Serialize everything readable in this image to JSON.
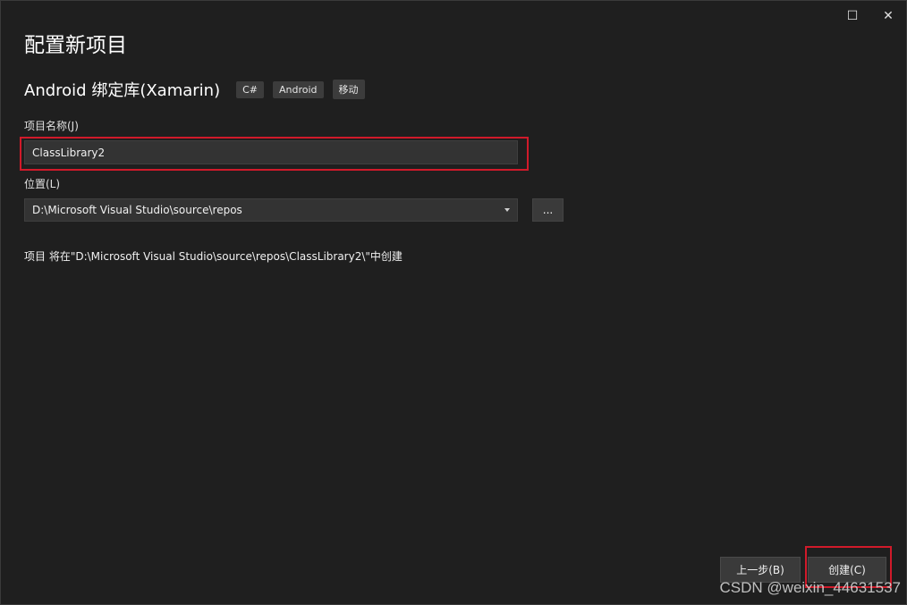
{
  "window": {
    "maximize_icon": "maximize-icon",
    "close_icon": "close-icon",
    "maximize_glyph": "☐",
    "close_glyph": "✕"
  },
  "page": {
    "title": "配置新项目"
  },
  "template": {
    "name": "Android 绑定库(Xamarin)",
    "tags": [
      "C#",
      "Android",
      "移动"
    ]
  },
  "project_name": {
    "label": "项目名称(J)",
    "value": "ClassLibrary2"
  },
  "location": {
    "label": "位置(L)",
    "value": "D:\\Microsoft Visual Studio\\source\\repos",
    "browse_label": "..."
  },
  "note": "项目 将在\"D:\\Microsoft Visual Studio\\source\\repos\\ClassLibrary2\\\"中创建",
  "footer": {
    "back_label": "上一步(B)",
    "create_label": "创建(C)"
  },
  "watermark": "CSDN @weixin_44631537",
  "colors": {
    "background": "#1f1f1f",
    "input": "#333333",
    "button": "#3a3a3a",
    "highlight": "#d11a2a"
  }
}
